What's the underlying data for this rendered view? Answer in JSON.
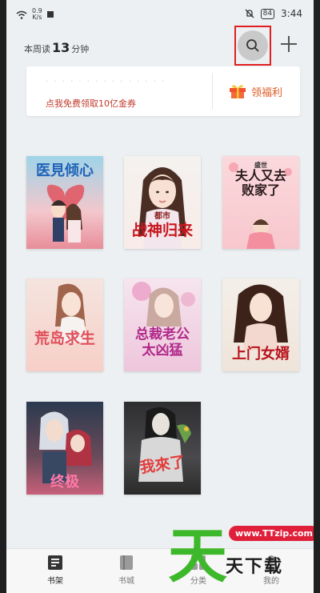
{
  "status": {
    "speed_value": "0.9",
    "speed_unit": "K/s",
    "battery": "84",
    "time": "3:44"
  },
  "header": {
    "read_prefix": "本周读",
    "read_minutes": "13",
    "read_suffix": "分钟"
  },
  "banner": {
    "text": "点我免费领取10亿金券",
    "reward_label": "领福利"
  },
  "books": [
    {
      "title": "医見倾心"
    },
    {
      "title_small": "都市",
      "title": "战神归来"
    },
    {
      "title_small": "盛世",
      "title": "夫人又去败家了"
    },
    {
      "title": "荒岛求生"
    },
    {
      "title": "总裁老公太凶猛"
    },
    {
      "title": "上门女婿"
    },
    {
      "title": "终极"
    },
    {
      "title": "我來了"
    }
  ],
  "tabs": [
    {
      "label": "书架"
    },
    {
      "label": "书城"
    },
    {
      "label": "分类"
    },
    {
      "label": "我的"
    }
  ],
  "watermark": {
    "badge": "www.TTzip.com",
    "text": "天下载",
    "big_char": "天"
  }
}
